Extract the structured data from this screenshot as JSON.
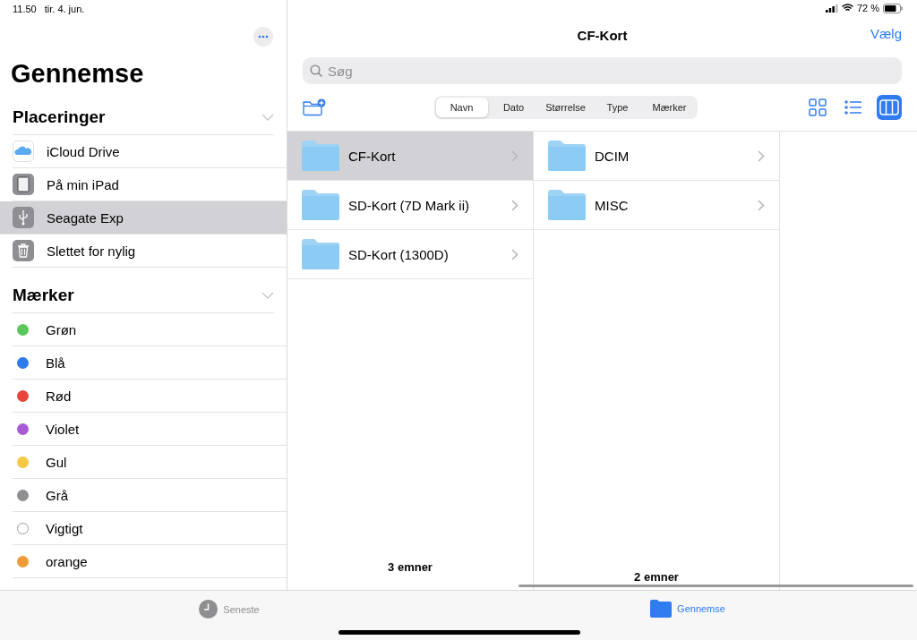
{
  "status_bar": {
    "time": "11.50",
    "date": "tir. 4. jun.",
    "battery": "72 %"
  },
  "sidebar": {
    "title": "Gennemse",
    "sections": [
      {
        "title": "Placeringer",
        "items": [
          {
            "label": "iCloud Drive",
            "kind": "icloud",
            "selected": false
          },
          {
            "label": "På min iPad",
            "kind": "ipad",
            "selected": false
          },
          {
            "label": "Seagate Exp",
            "kind": "usb",
            "selected": true
          },
          {
            "label": "Slettet for nylig",
            "kind": "trash",
            "selected": false
          }
        ]
      },
      {
        "title": "Mærker",
        "items": [
          {
            "label": "Grøn",
            "kind": "tag",
            "color": "#5ac85a"
          },
          {
            "label": "Blå",
            "kind": "tag",
            "color": "#2f7bf0"
          },
          {
            "label": "Rød",
            "kind": "tag",
            "color": "#e8463a"
          },
          {
            "label": "Violet",
            "kind": "tag",
            "color": "#a95bd6"
          },
          {
            "label": "Gul",
            "kind": "tag",
            "color": "#f6c843"
          },
          {
            "label": "Grå",
            "kind": "tag",
            "color": "#8e8e93"
          },
          {
            "label": "Vigtigt",
            "kind": "tag",
            "color": "#ffffff"
          },
          {
            "label": "orange",
            "kind": "tag",
            "color": "#f09a37"
          }
        ]
      }
    ]
  },
  "browser": {
    "title": "CF-Kort",
    "select_button": "Vælg",
    "search": {
      "placeholder": "Søg"
    },
    "sort_tabs": [
      {
        "label": "Navn",
        "selected": true
      },
      {
        "label": "Dato",
        "selected": false
      },
      {
        "label": "Størrelse",
        "selected": false
      },
      {
        "label": "Type",
        "selected": false
      },
      {
        "label": "Mærker",
        "selected": false
      }
    ],
    "view_modes": [
      {
        "kind": "grid",
        "selected": false
      },
      {
        "kind": "list",
        "selected": false
      },
      {
        "kind": "columns",
        "selected": true
      }
    ],
    "columns": [
      {
        "items": [
          {
            "name": "CF-Kort",
            "selected": true
          },
          {
            "name": "SD-Kort (7D Mark ii)",
            "selected": false
          },
          {
            "name": "SD-Kort (1300D)",
            "selected": false
          }
        ],
        "footer": "3 emner"
      },
      {
        "items": [
          {
            "name": "DCIM",
            "selected": false
          },
          {
            "name": "MISC",
            "selected": false
          }
        ],
        "footer": "2 emner"
      }
    ]
  },
  "tab_bar": [
    {
      "label": "Seneste",
      "kind": "recent",
      "selected": false
    },
    {
      "label": "Gennemse",
      "kind": "browse",
      "selected": true
    }
  ]
}
